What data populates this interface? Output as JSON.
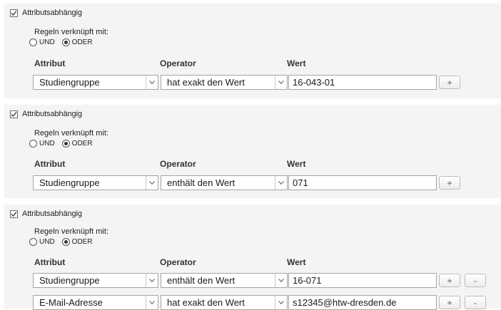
{
  "blocks": [
    {
      "checkbox_label": "Attributsabhängig",
      "rules_label": "Regeln verknüpft mit:",
      "radio_und": "UND",
      "radio_oder": "ODER",
      "selected": "ODER",
      "headers": {
        "attribut": "Attribut",
        "operator": "Operator",
        "wert": "Wert"
      },
      "rows": [
        {
          "attribut": "Studiengruppe",
          "operator": "hat exakt den Wert",
          "wert": "16-043-01",
          "add": "+",
          "remove": null
        }
      ]
    },
    {
      "checkbox_label": "Attributsabhängig",
      "rules_label": "Regeln verknüpft mit:",
      "radio_und": "UND",
      "radio_oder": "ODER",
      "selected": "ODER",
      "headers": {
        "attribut": "Attribut",
        "operator": "Operator",
        "wert": "Wert"
      },
      "rows": [
        {
          "attribut": "Studiengruppe",
          "operator": "enthält den Wert",
          "wert": "071",
          "add": "+",
          "remove": null
        }
      ]
    },
    {
      "checkbox_label": "Attributsabhängig",
      "rules_label": "Regeln verknüpft mit:",
      "radio_und": "UND",
      "radio_oder": "ODER",
      "selected": "ODER",
      "headers": {
        "attribut": "Attribut",
        "operator": "Operator",
        "wert": "Wert"
      },
      "rows": [
        {
          "attribut": "Studiengruppe",
          "operator": "enthält den Wert",
          "wert": "16-071",
          "add": "+",
          "remove": "-"
        },
        {
          "attribut": "E-Mail-Adresse",
          "operator": "hat exakt den Wert",
          "wert": "s12345@htw-dresden.de",
          "add": "+",
          "remove": "-"
        }
      ]
    }
  ]
}
